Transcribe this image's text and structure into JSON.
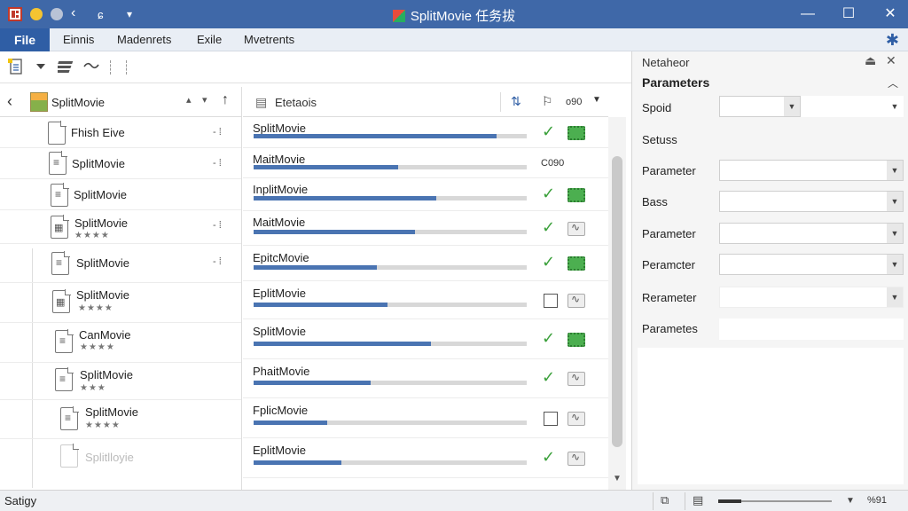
{
  "window": {
    "title": "SplitMovie 任务拔",
    "back_glyph": "‹",
    "nav_glyph": "ɕ",
    "menu_glyph": "▾",
    "min_glyph": "—",
    "max_glyph": "☐",
    "close_glyph": "✕"
  },
  "menu": {
    "file": "File",
    "items": [
      "Einnis",
      "Madenrets",
      "Exile",
      "Mvetrents"
    ],
    "settings_glyph": "✱"
  },
  "toolbar": {
    "icons": [
      "new-doc-icon",
      "dropdown-icon",
      "stack-icon",
      "wave-icon"
    ]
  },
  "left": {
    "header": {
      "name": "SplitMovie",
      "sort1": "▴",
      "sort2": "▾",
      "up": "↑",
      "back": "‹"
    },
    "rows": [
      {
        "name": "Fhish Eive",
        "stars": "",
        "action": "- ⁞"
      },
      {
        "name": "SplitMovie",
        "stars": "",
        "action": "- ⁞"
      },
      {
        "name": "SplitMovie",
        "stars": "",
        "action": ""
      },
      {
        "name": "SplitMovie",
        "stars": "★★★★",
        "action": "- ⁞"
      },
      {
        "name": "SplitMovie",
        "stars": "",
        "action": "- ⁞"
      },
      {
        "name": "SplitMovie",
        "stars": "★★★★",
        "action": ""
      },
      {
        "name": "CanMovie",
        "stars": "★★★★",
        "action": ""
      },
      {
        "name": "SplitMovie",
        "stars": "★★★",
        "action": ""
      },
      {
        "name": "SplitMovie",
        "stars": "★★★★",
        "action": ""
      },
      {
        "name": "Splitlloyie",
        "stars": "",
        "action": ""
      }
    ]
  },
  "middle": {
    "header": {
      "label": "Etetaois",
      "zoom": "o90"
    },
    "tasks": [
      {
        "name": "SplitMovie",
        "progress": 0.89,
        "status": "check",
        "badge": "green"
      },
      {
        "name": "MaitMovie",
        "progress": 0.53,
        "status": "code",
        "code": "C090",
        "badge": ""
      },
      {
        "name": "InplitMovie",
        "progress": 0.67,
        "status": "check",
        "badge": "green"
      },
      {
        "name": "MaitMovie",
        "progress": 0.59,
        "status": "check",
        "badge": "gray"
      },
      {
        "name": "EpitcMovie",
        "progress": 0.45,
        "status": "check",
        "badge": "green"
      },
      {
        "name": "EplitMovie",
        "progress": 0.49,
        "status": "box",
        "badge": "gray"
      },
      {
        "name": "SplitMovie",
        "progress": 0.65,
        "status": "check",
        "badge": "green"
      },
      {
        "name": "PhaitMovie",
        "progress": 0.43,
        "status": "check",
        "badge": "gray"
      },
      {
        "name": "FplicMovie",
        "progress": 0.27,
        "status": "box",
        "badge": "gray"
      },
      {
        "name": "EplitMovie",
        "progress": 0.32,
        "status": "check",
        "badge": "gray"
      }
    ]
  },
  "right": {
    "title": "Netaheor",
    "section": "Parameters",
    "params": [
      {
        "label": "Spoid"
      },
      {
        "label": "Setuss"
      },
      {
        "label": "Parameter"
      },
      {
        "label": "Bass"
      },
      {
        "label": "Parameter"
      },
      {
        "label": "Peramcter"
      },
      {
        "label": "Rerameter"
      },
      {
        "label": "Parametes"
      }
    ]
  },
  "status": {
    "text": "Satigy",
    "zoom": "%91",
    "zoom_level": 0.2
  }
}
